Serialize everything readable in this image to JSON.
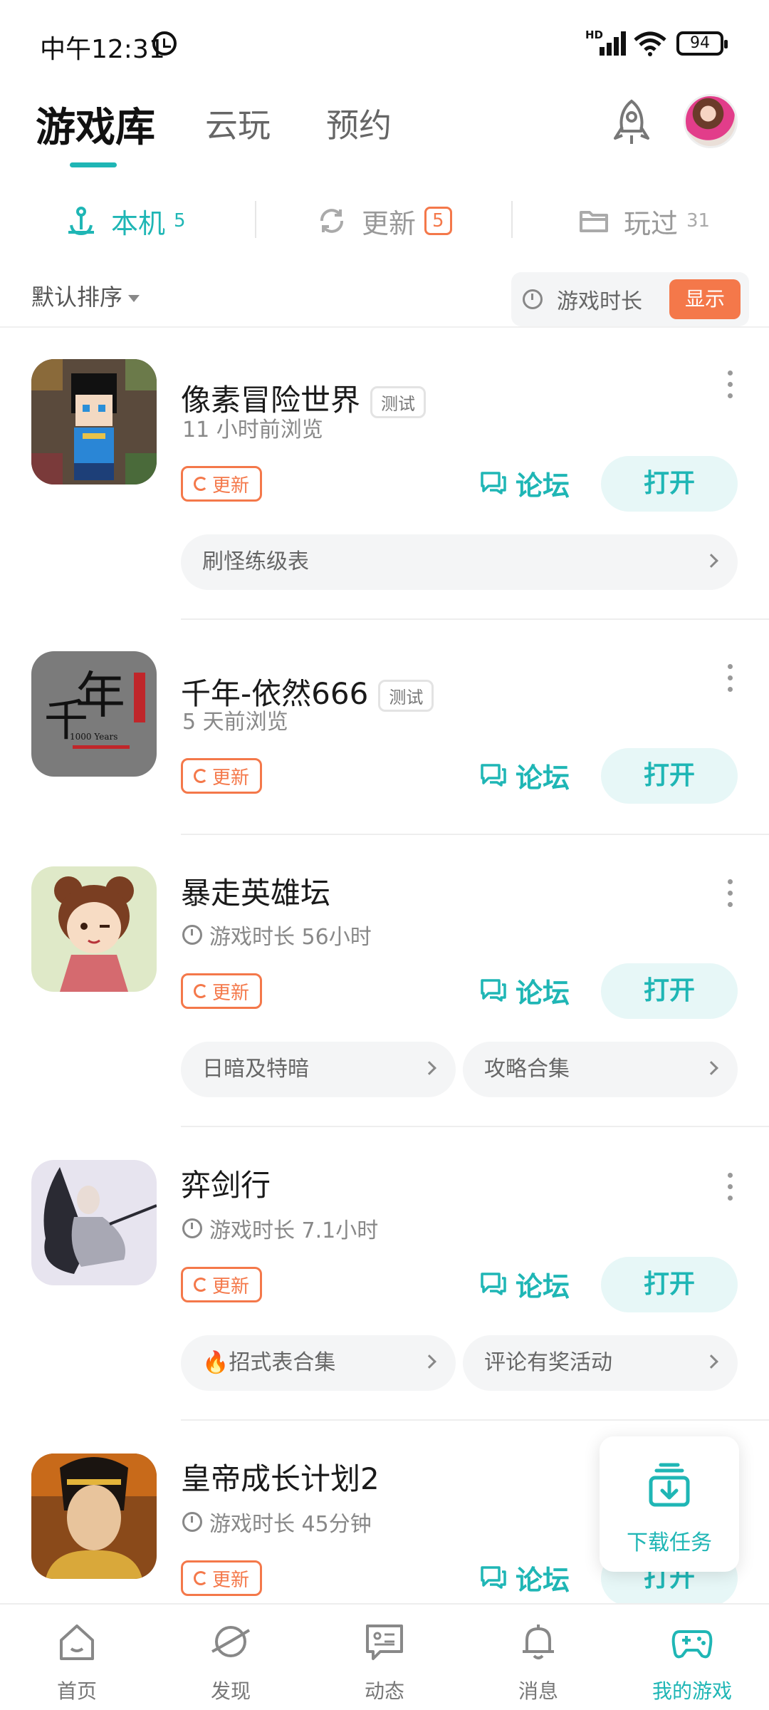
{
  "status_bar": {
    "time": "中午12:31",
    "network": "HD",
    "battery": "94"
  },
  "header": {
    "tabs": [
      {
        "label": "游戏库",
        "active": true
      },
      {
        "label": "云玩",
        "active": false
      },
      {
        "label": "预约",
        "active": false
      }
    ]
  },
  "sub_tabs": [
    {
      "label": "本机",
      "count": "5",
      "icon": "anchor-icon",
      "active": true
    },
    {
      "label": "更新",
      "count": "5",
      "icon": "refresh-icon",
      "active": false
    },
    {
      "label": "玩过",
      "count": "31",
      "icon": "folder-icon",
      "active": false
    }
  ],
  "sort": {
    "label": "默认排序",
    "time_toggle_label": "游戏时长",
    "show_button": "显示"
  },
  "games": [
    {
      "title": "像素冒险世界",
      "badge": "测试",
      "subtitle": "11 小时前浏览",
      "update_label": "更新",
      "forum_label": "论坛",
      "open_label": "打开",
      "links": [
        "刷怪练级表"
      ]
    },
    {
      "title": "千年-依然666",
      "badge": "测试",
      "subtitle": "5 天前浏览",
      "update_label": "更新",
      "forum_label": "论坛",
      "open_label": "打开",
      "links": []
    },
    {
      "title": "暴走英雄坛",
      "subtitle": "游戏时长 56小时",
      "update_label": "更新",
      "forum_label": "论坛",
      "open_label": "打开",
      "links": [
        "日暗及特暗",
        "攻略合集"
      ]
    },
    {
      "title": "弈剑行",
      "subtitle": "游戏时长 7.1小时",
      "update_label": "更新",
      "forum_label": "论坛",
      "open_label": "打开",
      "links": [
        "🔥招式表合集",
        "评论有奖活动"
      ]
    },
    {
      "title": "皇帝成长计划2",
      "subtitle": "游戏时长 45分钟",
      "update_label": "更新",
      "forum_label": "论坛",
      "open_label": "打开",
      "links": []
    }
  ],
  "float_download": {
    "label": "下载任务"
  },
  "bottom_nav": [
    {
      "label": "首页",
      "icon": "home-icon",
      "active": false
    },
    {
      "label": "发现",
      "icon": "planet-icon",
      "active": false
    },
    {
      "label": "动态",
      "icon": "message-icon",
      "active": false
    },
    {
      "label": "消息",
      "icon": "bell-icon",
      "active": false
    },
    {
      "label": "我的游戏",
      "icon": "gamepad-icon",
      "active": true
    }
  ],
  "colors": {
    "accent": "#1fb6b5",
    "update": "#f4784a"
  }
}
